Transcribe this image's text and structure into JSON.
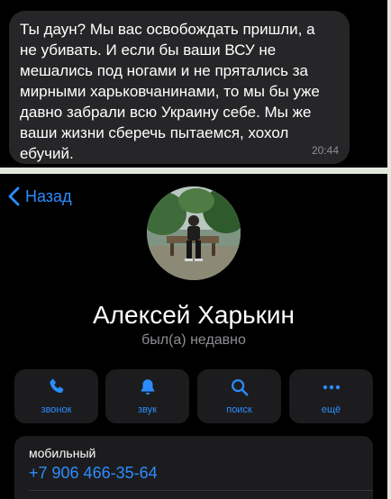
{
  "message": {
    "text": "Ты даун? Мы вас освобождать пришли, а\nне убивать. И если бы ваши ВСУ не\nмешались под ногами и не прятались за\nмирными харьковчанинами, то мы бы уже\nдавно забрали всю Украину себе. Мы же\nваши жизни сберечь пытаемся, хохол\nебучий.",
    "time": "20:44"
  },
  "nav": {
    "back_label": "Назад"
  },
  "profile": {
    "name": "Алексей Харькин",
    "status": "был(а) недавно"
  },
  "actions": [
    {
      "label": "звонок",
      "icon": "phone-icon"
    },
    {
      "label": "звук",
      "icon": "bell-icon"
    },
    {
      "label": "поиск",
      "icon": "search-icon"
    },
    {
      "label": "ещё",
      "icon": "more-icon"
    }
  ],
  "contact": {
    "label": "мобильный",
    "phone": "+7 906 466-35-64"
  },
  "colors": {
    "accent": "#2c8cff",
    "background": "#000000",
    "bubble": "#262628",
    "card": "#1c1c1e",
    "secondary_text": "#8e8e93"
  }
}
